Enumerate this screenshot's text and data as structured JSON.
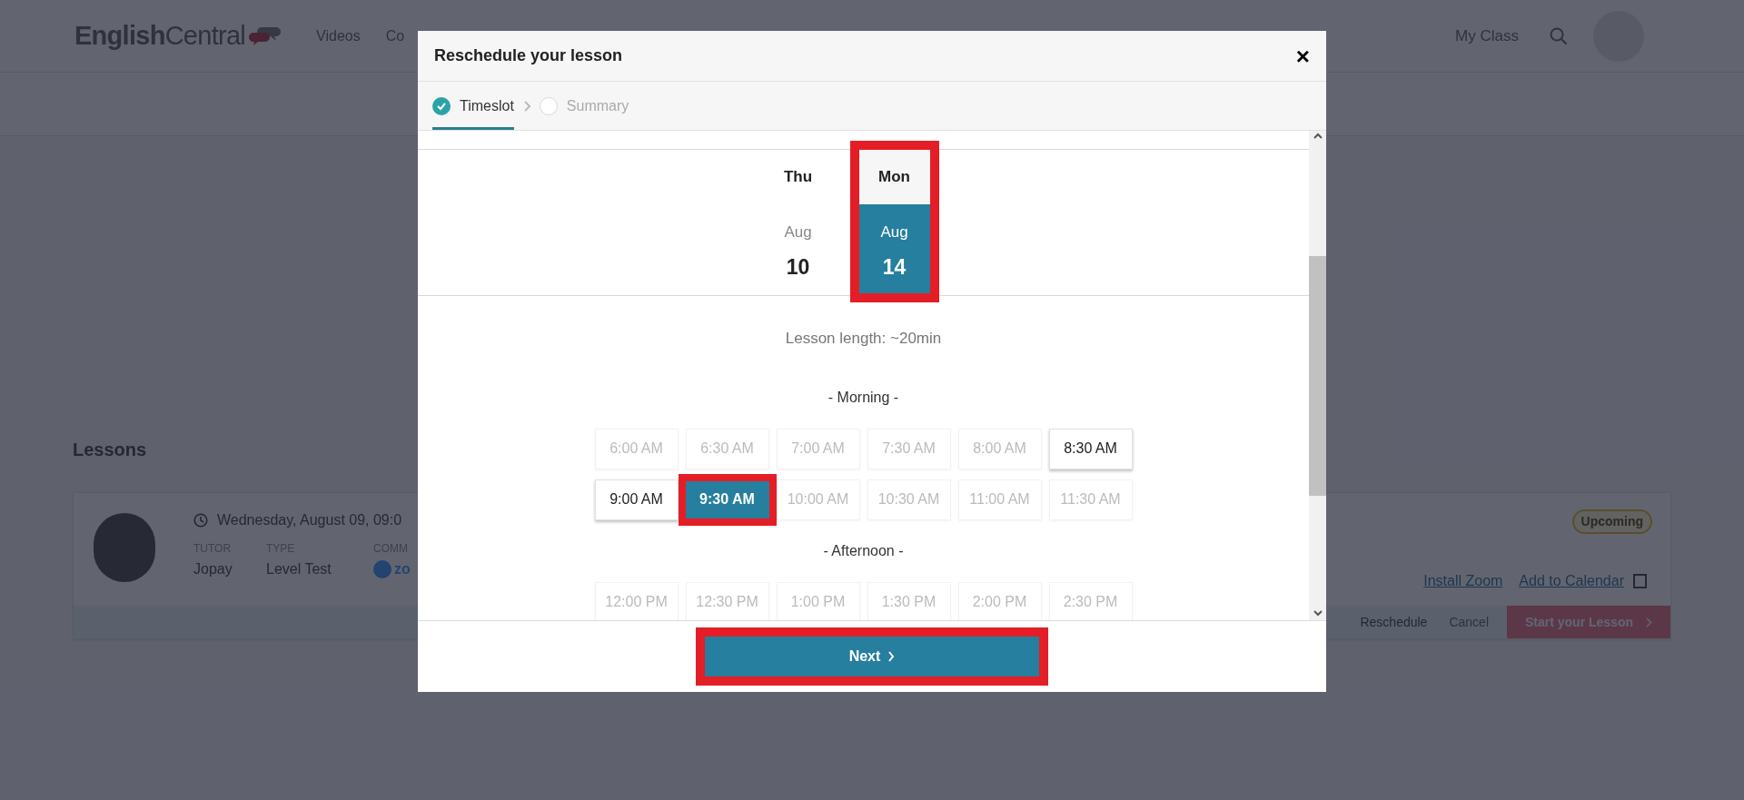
{
  "header": {
    "logo": "**English**Central",
    "nav": [
      "Videos",
      "Co"
    ],
    "my_class": "My Class"
  },
  "lessons": {
    "heading": "Lessons",
    "lesson": {
      "date": "Wednesday, August 09, 09:0",
      "tutor_label": "TUTOR",
      "tutor": "Jopay",
      "type_label": "TYPE",
      "type": "Level Test",
      "comm_label": "COMM",
      "comm": "zo",
      "status": "Upcoming",
      "links": [
        "Install Zoom",
        "Add to Calendar"
      ],
      "reschedule": "Reschedule",
      "cancel": "Cancel",
      "start": "Start your Lesson"
    }
  },
  "modal": {
    "title": "Reschedule your lesson",
    "close": "×",
    "steps": [
      {
        "label": "Timeslot",
        "done": true,
        "selected": true
      },
      {
        "label": "Summary",
        "done": false,
        "selected": false
      }
    ],
    "days": [
      {
        "weekday": "Thu",
        "month": "Aug",
        "day": "10",
        "selected": false
      },
      {
        "weekday": "Mon",
        "month": "Aug",
        "day": "14",
        "selected": true
      }
    ],
    "lesson_length": "Lesson length: ~20min",
    "sections": [
      {
        "label": "- Morning -",
        "slots": [
          {
            "time": "6:00 AM",
            "available": false,
            "selected": false
          },
          {
            "time": "6:30 AM",
            "available": false,
            "selected": false
          },
          {
            "time": "7:00 AM",
            "available": false,
            "selected": false
          },
          {
            "time": "7:30 AM",
            "available": false,
            "selected": false
          },
          {
            "time": "8:00 AM",
            "available": false,
            "selected": false
          },
          {
            "time": "8:30 AM",
            "available": true,
            "selected": false
          },
          {
            "time": "9:00 AM",
            "available": true,
            "selected": false
          },
          {
            "time": "9:30 AM",
            "available": true,
            "selected": true
          },
          {
            "time": "10:00 AM",
            "available": false,
            "selected": false
          },
          {
            "time": "10:30 AM",
            "available": false,
            "selected": false
          },
          {
            "time": "11:00 AM",
            "available": false,
            "selected": false
          },
          {
            "time": "11:30 AM",
            "available": false,
            "selected": false
          }
        ]
      },
      {
        "label": "- Afternoon -",
        "slots": [
          {
            "time": "12:00 PM",
            "available": false,
            "selected": false
          },
          {
            "time": "12:30 PM",
            "available": false,
            "selected": false
          },
          {
            "time": "1:00 PM",
            "available": false,
            "selected": false
          },
          {
            "time": "1:30 PM",
            "available": false,
            "selected": false
          },
          {
            "time": "2:00 PM",
            "available": false,
            "selected": false
          },
          {
            "time": "2:30 PM",
            "available": false,
            "selected": false
          }
        ]
      }
    ],
    "next": "Next"
  }
}
